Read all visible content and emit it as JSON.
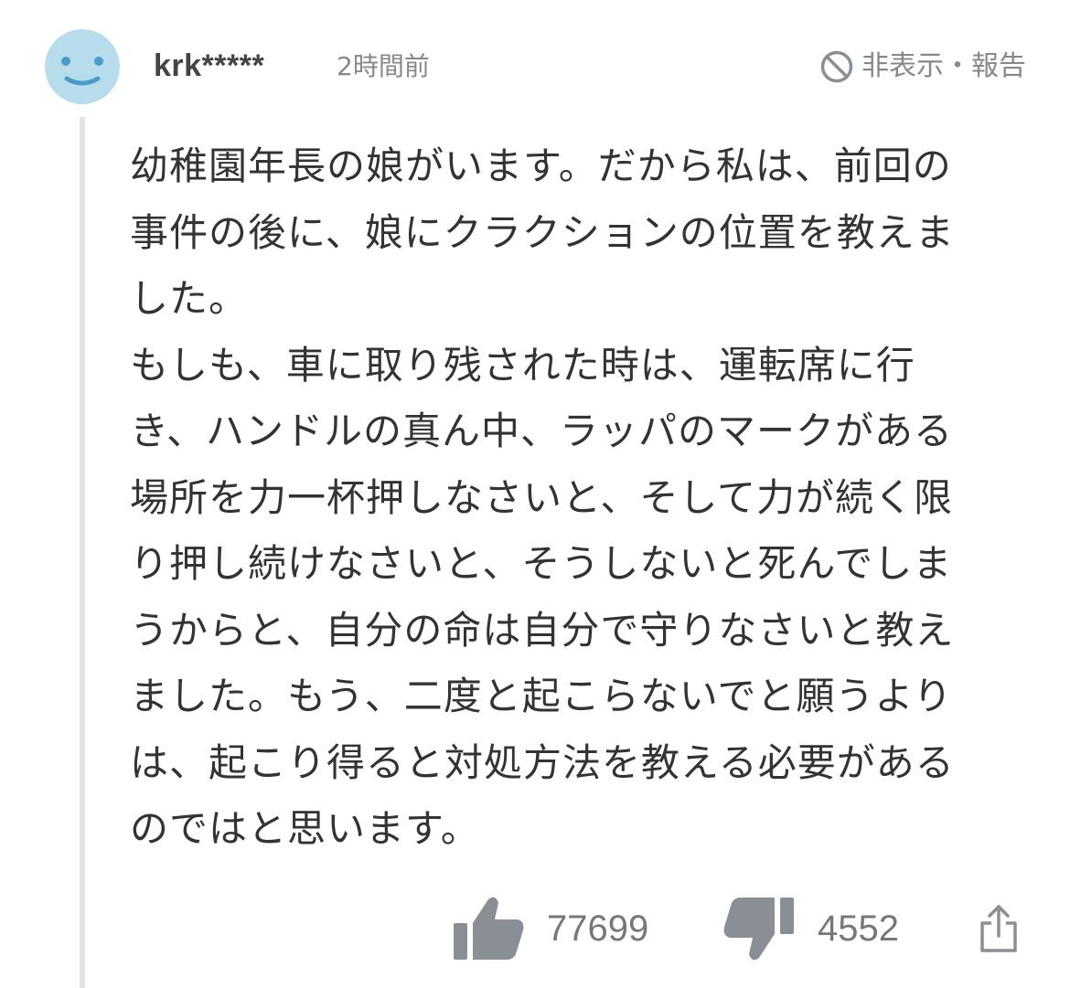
{
  "comment": {
    "avatar_icon": "smiley-avatar-icon",
    "username": "krk*****",
    "timestamp": "2時間前",
    "report": {
      "icon": "prohibited-icon",
      "label": "非表示・報告"
    },
    "body": "幼稚園年長の娘がいます。だから私は、前回の\n事件の後に、娘にクラクションの位置を教えま\nした。\nもしも、車に取り残された時は、運転席に行\nき、ハンドルの真ん中、ラッパのマークがある\n場所を力一杯押しなさいと、そして力が続く限\nり押し続けなさいと、そうしないと死んでしま\nうからと、自分の命は自分で守りなさいと教え\nました。もう、二度と起こらないでと願うより\nは、起こり得ると対処方法を教える必要がある\nのではと思います。",
    "actions": {
      "like": {
        "icon": "thumbs-up-icon",
        "count": "77699"
      },
      "dislike": {
        "icon": "thumbs-down-icon",
        "count": "4552"
      },
      "share": {
        "icon": "share-icon"
      }
    }
  },
  "colors": {
    "avatar_bg": "#b7dcec",
    "avatar_face": "#4a9cc8",
    "text": "#333333",
    "muted": "#888888",
    "thread_line": "#e3e3e3",
    "icon_gray": "#8a8f96"
  }
}
